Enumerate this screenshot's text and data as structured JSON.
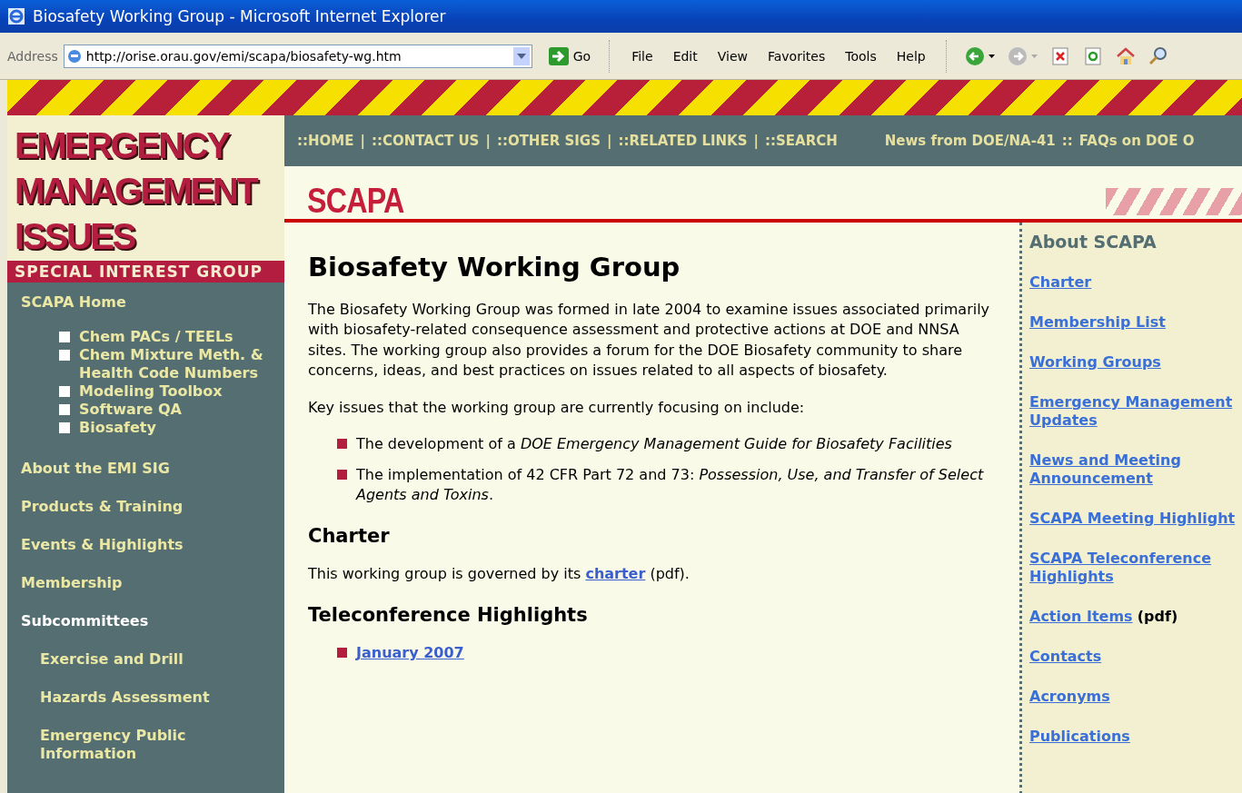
{
  "window": {
    "title": "Biosafety Working Group - Microsoft Internet Explorer"
  },
  "toolbar": {
    "address_label": "Address",
    "url": "http://orise.orau.gov/emi/scapa/biosafety-wg.htm",
    "go_label": "Go",
    "menus": [
      "File",
      "Edit",
      "View",
      "Favorites",
      "Tools",
      "Help"
    ]
  },
  "banner": {
    "logo_lines": [
      "EMERGENCY",
      "MANAGEMENT",
      "ISSUES"
    ],
    "subtitle": "SPECIAL INTEREST GROUP"
  },
  "top_nav": {
    "links": [
      "::HOME",
      "::CONTACT US",
      "::OTHER SIGS",
      "::RELATED LINKS",
      "::SEARCH"
    ],
    "separator": "|",
    "extra": [
      "News from DOE/NA-41",
      "::",
      "FAQs on DOE O"
    ]
  },
  "section_title": "SCAPA",
  "left_nav": [
    {
      "label": "SCAPA Home",
      "kind": "link",
      "children": [
        {
          "label": "Chem PACs / TEELs"
        },
        {
          "label": "Chem Mixture Meth. & Health Code Numbers"
        },
        {
          "label": "Modeling Toolbox"
        },
        {
          "label": "Software QA"
        },
        {
          "label": "Biosafety"
        }
      ]
    },
    {
      "label": "About the EMI SIG",
      "kind": "link"
    },
    {
      "label": "Products & Training",
      "kind": "link"
    },
    {
      "label": "Events & Highlights",
      "kind": "link"
    },
    {
      "label": "Membership",
      "kind": "link"
    },
    {
      "label": "Subcommittees",
      "kind": "heading"
    },
    {
      "label": "Exercise and Drill",
      "kind": "sub"
    },
    {
      "label": "Hazards Assessment",
      "kind": "sub"
    },
    {
      "label": "Emergency Public Information",
      "kind": "sub"
    }
  ],
  "content": {
    "heading": "Biosafety Working Group",
    "intro": "The Biosafety Working Group was formed in late 2004 to examine issues associated primarily with biosafety-related consequence assessment and protective actions at DOE and NNSA sites.   The working group also provides a forum for the DOE Biosafety community to share concerns, ideas, and best practices on issues related to all aspects of biosafety.",
    "issues_intro": "Key issues that the working group are currently focusing on include:",
    "issues": [
      "The development of a *DOE Emergency Management Guide for Biosafety Facilities*",
      "The implementation of 42 CFR Part 72 and 73: *Possession, Use, and Transfer of Select Agents and Toxins*."
    ],
    "charter_heading": "Charter",
    "charter_sentence": {
      "before": "This working group is governed by its ",
      "link": "charter",
      "after": " (pdf)."
    },
    "teleconference_heading": "Teleconference Highlights",
    "teleconference_links": [
      "January 2007"
    ]
  },
  "right_sidebar": {
    "title": "About SCAPA",
    "links": [
      {
        "label": "Charter"
      },
      {
        "label": "Membership List"
      },
      {
        "label": "Working Groups"
      },
      {
        "label": "Emergency Management Updates"
      },
      {
        "label": "News and Meeting Announcement"
      },
      {
        "label": "SCAPA Meeting Highlight"
      },
      {
        "label": "SCAPA Teleconference Highlights"
      },
      {
        "label": "Action Items",
        "note": "(pdf)"
      },
      {
        "label": "Contacts"
      },
      {
        "label": "Acronyms"
      },
      {
        "label": "Publications"
      }
    ]
  }
}
